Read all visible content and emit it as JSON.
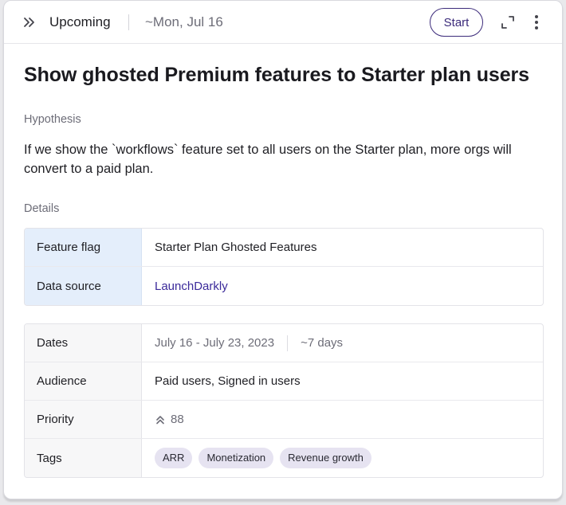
{
  "header": {
    "status": "Upcoming",
    "date": "~Mon, Jul 16",
    "start_label": "Start"
  },
  "title": "Show ghosted Premium features to Starter plan users",
  "hypothesis": {
    "label": "Hypothesis",
    "text": "If we show the `workflows` feature set to all users on the Starter plan, more orgs will convert to a paid plan."
  },
  "details": {
    "label": "Details",
    "feature_flag": {
      "key": "Feature flag",
      "value": "Starter Plan Ghosted Features"
    },
    "data_source": {
      "key": "Data source",
      "value": "LaunchDarkly"
    },
    "dates": {
      "key": "Dates",
      "range": "July 16 - July 23, 2023",
      "duration": "~7 days"
    },
    "audience": {
      "key": "Audience",
      "value": "Paid users, Signed in users"
    },
    "priority": {
      "key": "Priority",
      "value": "88"
    },
    "tags": {
      "key": "Tags",
      "items": [
        "ARR",
        "Monetization",
        "Revenue growth"
      ]
    }
  },
  "colors": {
    "accent": "#3b2a7a",
    "link": "#3b2a9a",
    "key_highlight": "#e4eefb",
    "tag_bg": "#e6e3f1"
  },
  "icons": {
    "expand": "double-chevron-right-icon",
    "fullscreen": "fullscreen-icon",
    "more": "vertical-ellipsis-icon",
    "priority": "double-chevron-up-icon"
  }
}
